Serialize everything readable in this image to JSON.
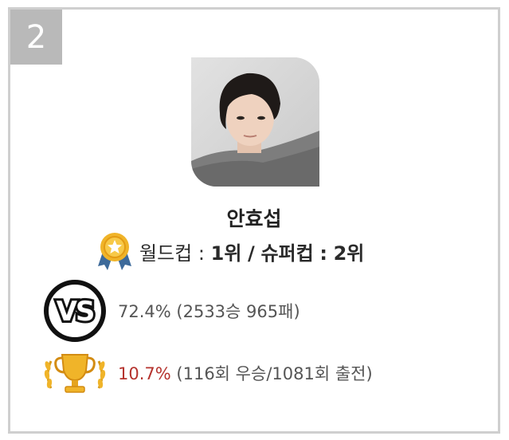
{
  "card": {
    "rank_number": "2",
    "name": "안효섭",
    "worldcup_label": "월드컵",
    "worldcup_rank": "1위",
    "divider": "/",
    "supercup_label": "슈퍼컵",
    "supercup_rank": "2위",
    "colon": ":"
  },
  "vs_stats": {
    "icon": "vs-icon",
    "win_rate": "72.4%",
    "detail": "(2533승 965패)"
  },
  "win_stats": {
    "icon": "trophy-icon",
    "win_pct": "10.7%",
    "detail": "(116회 우승/1081회 출전)"
  },
  "colors": {
    "badge_bg": "#b9b9b9",
    "border": "#cfcfcf",
    "accent_red": "#b5332e",
    "medal_gold": "#f0b429",
    "ribbon_blue": "#3d6a9a"
  }
}
